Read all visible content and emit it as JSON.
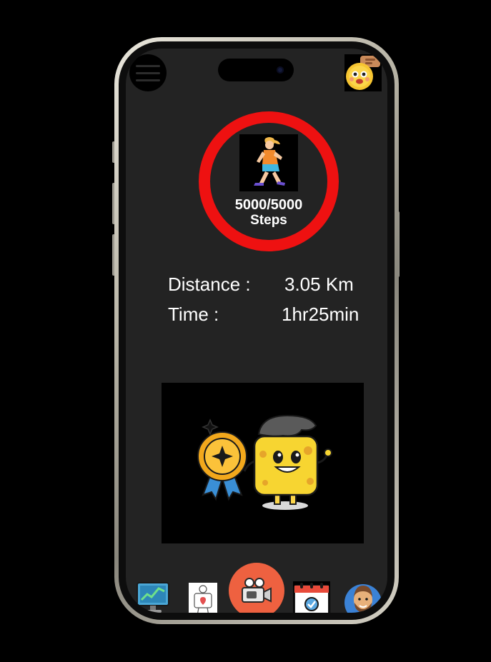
{
  "header": {
    "menu_icon": "hamburger-menu-icon",
    "mascot_icon": "chat-mascot-icon"
  },
  "steps": {
    "current": 5000,
    "goal": 5000,
    "count_text": "5000/5000",
    "label": "Steps",
    "progress": 1.0,
    "ring_color": "#ee1111",
    "icon": "walking-person-icon"
  },
  "stats": {
    "distance_label": "Distance :",
    "distance_value": "3.05 Km",
    "time_label": "Time :",
    "time_value": "1hr25min"
  },
  "reward": {
    "icon": "medal-sponge-mascot-illustration"
  },
  "nav": {
    "items": [
      {
        "name": "stats-monitor-icon"
      },
      {
        "name": "map-pin-icon"
      },
      {
        "name": "video-camera-icon",
        "accent": "#ee6140"
      },
      {
        "name": "calendar-check-icon"
      },
      {
        "name": "profile-avatar-icon"
      }
    ]
  }
}
